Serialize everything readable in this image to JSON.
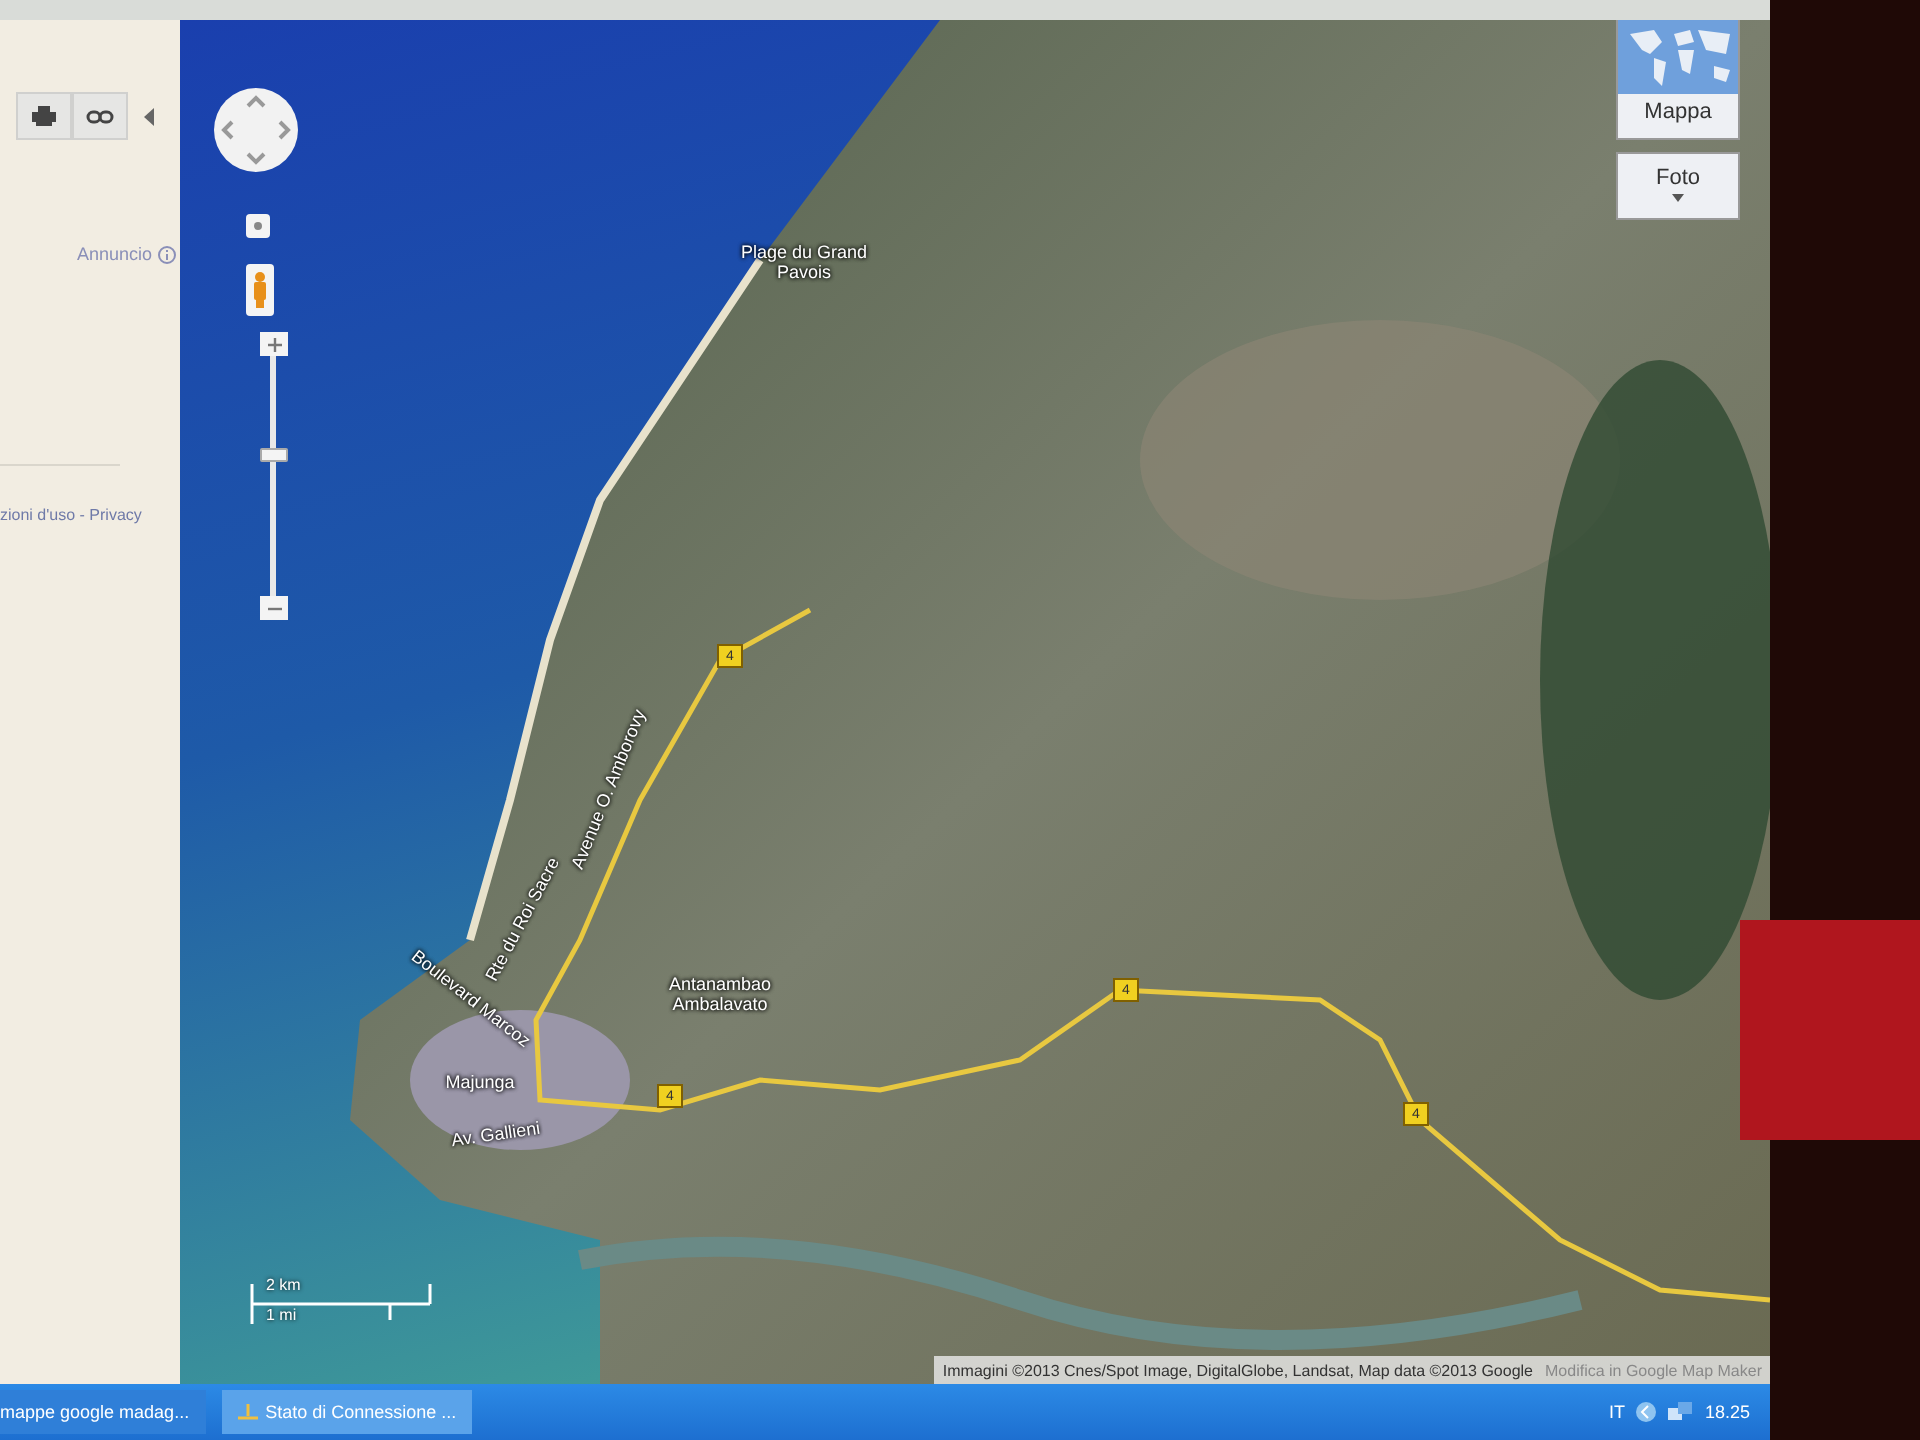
{
  "sidebar": {
    "ad_label": "Annuncio",
    "footer_links": "zioni d'uso - Privacy"
  },
  "map": {
    "labels": [
      "Plage du Grand Pavois",
      "Avenue O. Amborovy",
      "Rte du Roi Sacre",
      "Boulevard Marcoz",
      "Antanambao Ambalavato",
      "Majunga",
      "Av. Gallieni"
    ],
    "route_shields": [
      "4",
      "4",
      "4",
      "4"
    ],
    "zoom_slider": {
      "level": 0.62
    },
    "map_types": [
      {
        "label": "Mappa",
        "kind": "thumbnail"
      },
      {
        "label": "Foto",
        "kind": "dropdown"
      }
    ],
    "scale": {
      "metric": "2 km",
      "imperial": "1 mi"
    },
    "attribution": "Immagini ©2013 Cnes/Spot Image, DigitalGlobe, Landsat, Map data ©2013 Google",
    "edit_link": "Modifica in Google Map Maker"
  },
  "taskbar": {
    "items": [
      "mappe google madag...",
      "Stato di Connessione ..."
    ],
    "language": "IT",
    "clock": "18.25"
  }
}
